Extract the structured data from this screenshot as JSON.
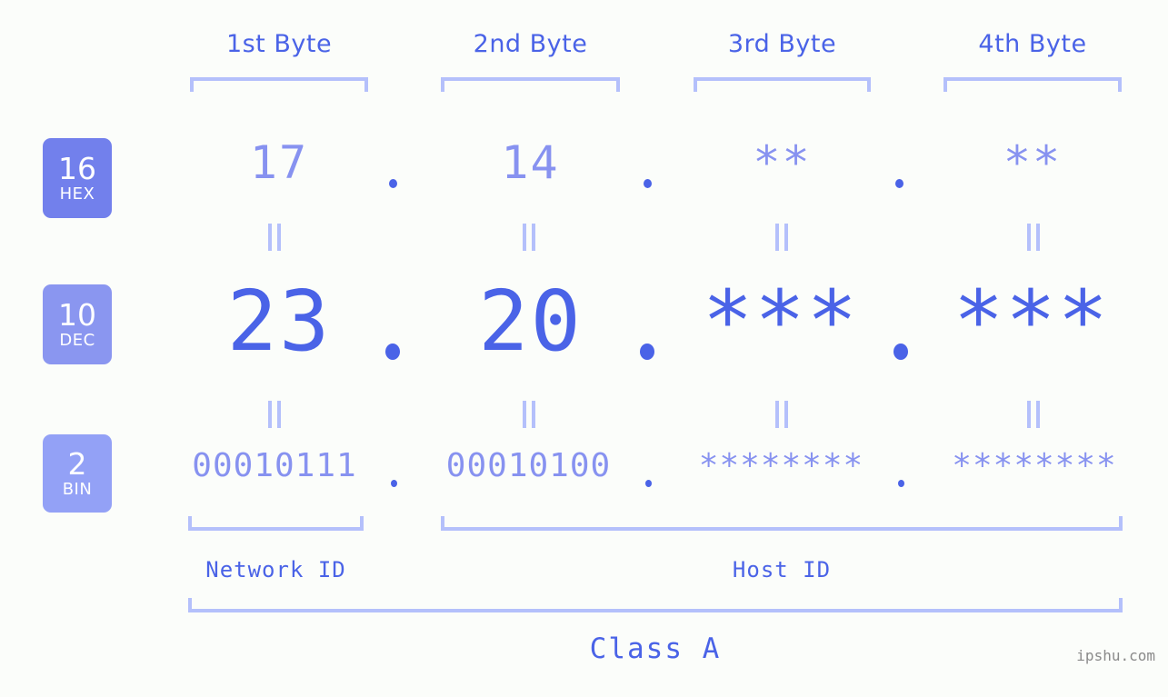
{
  "theme": {
    "background": "#fbfdfa",
    "accent_strong": "#4a63e7",
    "accent_mid": "#8792f0",
    "accent_light": "#b4c0fb",
    "badge_hex_bg": "#7280ec",
    "badge_dec_bg": "#8a96f0",
    "badge_bin_bg": "#93a1f6",
    "watermark_color": "#8a8a8a"
  },
  "byte_headers": [
    {
      "label": "1st Byte"
    },
    {
      "label": "2nd Byte"
    },
    {
      "label": "3rd Byte"
    },
    {
      "label": "4th Byte"
    }
  ],
  "bases": [
    {
      "number": "16",
      "name": "HEX"
    },
    {
      "number": "10",
      "name": "DEC"
    },
    {
      "number": "2",
      "name": "BIN"
    }
  ],
  "rows": {
    "hex": {
      "octets": [
        "17",
        "14",
        "**",
        "**"
      ]
    },
    "dec": {
      "octets": [
        "23",
        "20",
        "***",
        "***"
      ]
    },
    "bin": {
      "octets": [
        "00010111",
        "00010100",
        "********",
        "********"
      ]
    }
  },
  "separator": ".",
  "equals_glyph": "||",
  "sections": [
    {
      "label": "Network ID"
    },
    {
      "label": "Host ID"
    }
  ],
  "class": {
    "label": "Class A"
  },
  "watermark": {
    "text": "ipshu.com"
  }
}
